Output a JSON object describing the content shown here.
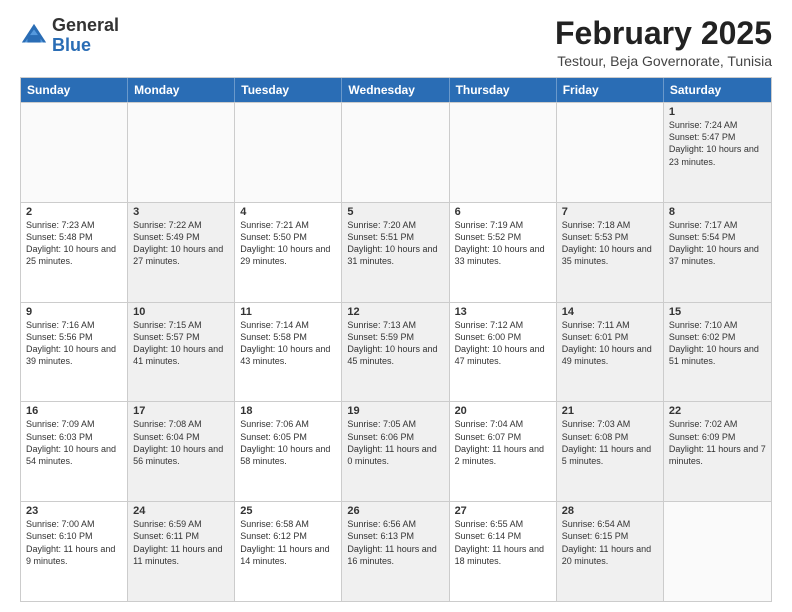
{
  "logo": {
    "general": "General",
    "blue": "Blue"
  },
  "header": {
    "month": "February 2025",
    "location": "Testour, Beja Governorate, Tunisia"
  },
  "weekdays": [
    "Sunday",
    "Monday",
    "Tuesday",
    "Wednesday",
    "Thursday",
    "Friday",
    "Saturday"
  ],
  "rows": [
    [
      {
        "day": "",
        "text": "",
        "empty": true
      },
      {
        "day": "",
        "text": "",
        "empty": true
      },
      {
        "day": "",
        "text": "",
        "empty": true
      },
      {
        "day": "",
        "text": "",
        "empty": true
      },
      {
        "day": "",
        "text": "",
        "empty": true
      },
      {
        "day": "",
        "text": "",
        "empty": true
      },
      {
        "day": "1",
        "text": "Sunrise: 7:24 AM\nSunset: 5:47 PM\nDaylight: 10 hours and 23 minutes.",
        "shaded": true
      }
    ],
    [
      {
        "day": "2",
        "text": "Sunrise: 7:23 AM\nSunset: 5:48 PM\nDaylight: 10 hours and 25 minutes."
      },
      {
        "day": "3",
        "text": "Sunrise: 7:22 AM\nSunset: 5:49 PM\nDaylight: 10 hours and 27 minutes.",
        "shaded": true
      },
      {
        "day": "4",
        "text": "Sunrise: 7:21 AM\nSunset: 5:50 PM\nDaylight: 10 hours and 29 minutes."
      },
      {
        "day": "5",
        "text": "Sunrise: 7:20 AM\nSunset: 5:51 PM\nDaylight: 10 hours and 31 minutes.",
        "shaded": true
      },
      {
        "day": "6",
        "text": "Sunrise: 7:19 AM\nSunset: 5:52 PM\nDaylight: 10 hours and 33 minutes."
      },
      {
        "day": "7",
        "text": "Sunrise: 7:18 AM\nSunset: 5:53 PM\nDaylight: 10 hours and 35 minutes.",
        "shaded": true
      },
      {
        "day": "8",
        "text": "Sunrise: 7:17 AM\nSunset: 5:54 PM\nDaylight: 10 hours and 37 minutes.",
        "shaded": true
      }
    ],
    [
      {
        "day": "9",
        "text": "Sunrise: 7:16 AM\nSunset: 5:56 PM\nDaylight: 10 hours and 39 minutes."
      },
      {
        "day": "10",
        "text": "Sunrise: 7:15 AM\nSunset: 5:57 PM\nDaylight: 10 hours and 41 minutes.",
        "shaded": true
      },
      {
        "day": "11",
        "text": "Sunrise: 7:14 AM\nSunset: 5:58 PM\nDaylight: 10 hours and 43 minutes."
      },
      {
        "day": "12",
        "text": "Sunrise: 7:13 AM\nSunset: 5:59 PM\nDaylight: 10 hours and 45 minutes.",
        "shaded": true
      },
      {
        "day": "13",
        "text": "Sunrise: 7:12 AM\nSunset: 6:00 PM\nDaylight: 10 hours and 47 minutes."
      },
      {
        "day": "14",
        "text": "Sunrise: 7:11 AM\nSunset: 6:01 PM\nDaylight: 10 hours and 49 minutes.",
        "shaded": true
      },
      {
        "day": "15",
        "text": "Sunrise: 7:10 AM\nSunset: 6:02 PM\nDaylight: 10 hours and 51 minutes.",
        "shaded": true
      }
    ],
    [
      {
        "day": "16",
        "text": "Sunrise: 7:09 AM\nSunset: 6:03 PM\nDaylight: 10 hours and 54 minutes."
      },
      {
        "day": "17",
        "text": "Sunrise: 7:08 AM\nSunset: 6:04 PM\nDaylight: 10 hours and 56 minutes.",
        "shaded": true
      },
      {
        "day": "18",
        "text": "Sunrise: 7:06 AM\nSunset: 6:05 PM\nDaylight: 10 hours and 58 minutes."
      },
      {
        "day": "19",
        "text": "Sunrise: 7:05 AM\nSunset: 6:06 PM\nDaylight: 11 hours and 0 minutes.",
        "shaded": true
      },
      {
        "day": "20",
        "text": "Sunrise: 7:04 AM\nSunset: 6:07 PM\nDaylight: 11 hours and 2 minutes."
      },
      {
        "day": "21",
        "text": "Sunrise: 7:03 AM\nSunset: 6:08 PM\nDaylight: 11 hours and 5 minutes.",
        "shaded": true
      },
      {
        "day": "22",
        "text": "Sunrise: 7:02 AM\nSunset: 6:09 PM\nDaylight: 11 hours and 7 minutes.",
        "shaded": true
      }
    ],
    [
      {
        "day": "23",
        "text": "Sunrise: 7:00 AM\nSunset: 6:10 PM\nDaylight: 11 hours and 9 minutes."
      },
      {
        "day": "24",
        "text": "Sunrise: 6:59 AM\nSunset: 6:11 PM\nDaylight: 11 hours and 11 minutes.",
        "shaded": true
      },
      {
        "day": "25",
        "text": "Sunrise: 6:58 AM\nSunset: 6:12 PM\nDaylight: 11 hours and 14 minutes."
      },
      {
        "day": "26",
        "text": "Sunrise: 6:56 AM\nSunset: 6:13 PM\nDaylight: 11 hours and 16 minutes.",
        "shaded": true
      },
      {
        "day": "27",
        "text": "Sunrise: 6:55 AM\nSunset: 6:14 PM\nDaylight: 11 hours and 18 minutes."
      },
      {
        "day": "28",
        "text": "Sunrise: 6:54 AM\nSunset: 6:15 PM\nDaylight: 11 hours and 20 minutes.",
        "shaded": true
      },
      {
        "day": "",
        "text": "",
        "empty": true
      }
    ]
  ]
}
